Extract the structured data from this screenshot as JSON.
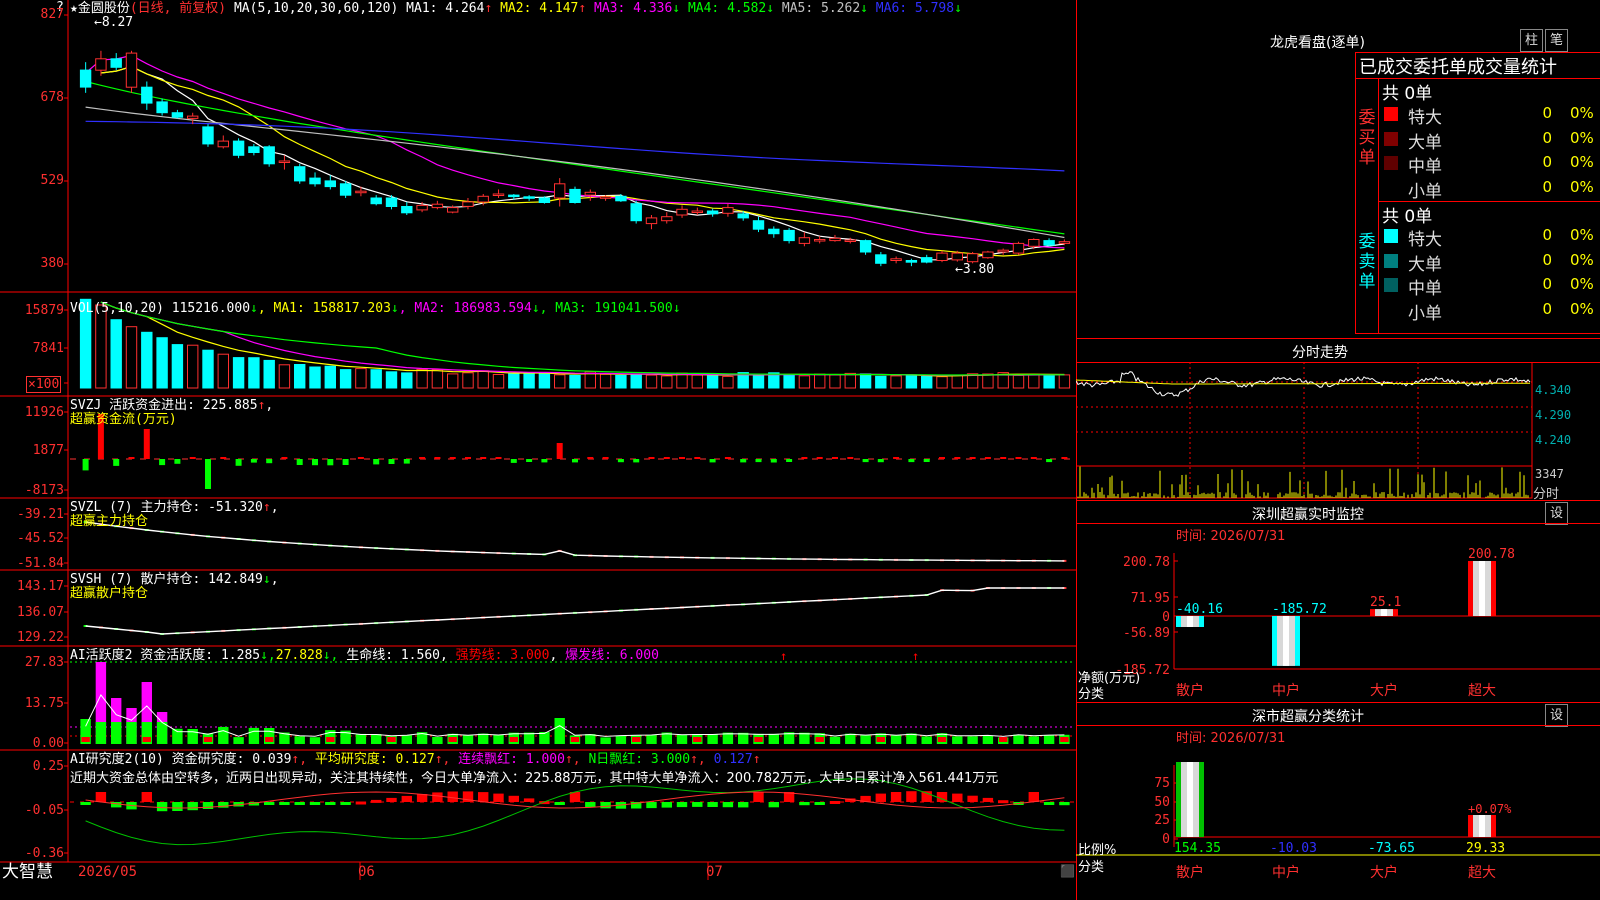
{
  "app": {
    "name": "大智慧",
    "corner_mark": "?"
  },
  "main_chart": {
    "title": "★金圆股份",
    "period": "(日线, 前复权)",
    "ma_head": "MA(5,10,20,30,60,120)",
    "ma": [
      {
        "text": "MA1: 4.264",
        "arrow": "↑",
        "color": "#ffffff"
      },
      {
        "text": "MA2: 4.147",
        "arrow": "↑",
        "color": "#ffff00"
      },
      {
        "text": "MA3: 4.336",
        "arrow": "↓",
        "color": "#ff00ff"
      },
      {
        "text": "MA4: 4.582",
        "arrow": "↓",
        "color": "#00ff00"
      },
      {
        "text": "MA5: 5.262",
        "arrow": "↓",
        "color": "#c0c0c0"
      },
      {
        "text": "MA6: 5.798",
        "arrow": "↓",
        "color": "#3030ff"
      }
    ],
    "y_ticks": [
      "827",
      "678",
      "529",
      "380"
    ],
    "high_mark": "8.27",
    "low_mark": "3.80",
    "candles": [
      [
        7.3,
        7.0,
        7.44,
        6.9
      ],
      [
        7.3,
        7.5,
        7.64,
        7.2
      ],
      [
        7.5,
        7.35,
        7.6,
        7.3
      ],
      [
        7.0,
        7.6,
        7.64,
        6.9
      ],
      [
        7.0,
        6.72,
        7.1,
        6.6
      ],
      [
        6.74,
        6.55,
        6.8,
        6.5
      ],
      [
        6.55,
        6.47,
        6.6,
        6.45
      ],
      [
        6.45,
        6.49,
        6.55,
        6.35
      ],
      [
        6.3,
        6.0,
        6.35,
        5.95
      ],
      [
        5.95,
        6.05,
        6.15,
        5.92
      ],
      [
        6.05,
        5.8,
        6.1,
        5.75
      ],
      [
        5.95,
        5.85,
        6.0,
        5.8
      ],
      [
        5.95,
        5.65,
        5.98,
        5.6
      ],
      [
        5.7,
        5.7,
        5.8,
        5.55
      ],
      [
        5.6,
        5.35,
        5.65,
        5.3
      ],
      [
        5.4,
        5.3,
        5.5,
        5.25
      ],
      [
        5.35,
        5.25,
        5.45,
        5.2
      ],
      [
        5.3,
        5.1,
        5.35,
        5.05
      ],
      [
        5.15,
        5.17,
        5.25,
        5.08
      ],
      [
        5.05,
        4.95,
        5.1,
        4.92
      ],
      [
        5.05,
        4.9,
        5.1,
        4.85
      ],
      [
        4.9,
        4.79,
        4.98,
        4.75
      ],
      [
        4.84,
        4.92,
        4.98,
        4.8
      ],
      [
        4.88,
        4.94,
        5.0,
        4.85
      ],
      [
        4.8,
        4.88,
        4.92,
        4.78
      ],
      [
        4.9,
        4.98,
        5.05,
        4.85
      ],
      [
        4.98,
        5.08,
        5.12,
        4.92
      ],
      [
        5.1,
        5.12,
        5.2,
        5.05
      ],
      [
        5.1,
        5.08,
        5.12,
        5.02
      ],
      [
        5.07,
        5.05,
        5.1,
        5.0
      ],
      [
        5.05,
        4.97,
        5.08,
        4.95
      ],
      [
        5.05,
        5.3,
        5.4,
        4.9
      ],
      [
        5.2,
        4.97,
        5.25,
        4.95
      ],
      [
        5.1,
        5.15,
        5.2,
        5.0
      ],
      [
        5.05,
        5.07,
        5.1,
        5.0
      ],
      [
        5.08,
        5.0,
        5.12,
        4.98
      ],
      [
        4.95,
        4.65,
        5.0,
        4.6
      ],
      [
        4.6,
        4.7,
        4.75,
        4.5
      ],
      [
        4.65,
        4.72,
        4.8,
        4.6
      ],
      [
        4.75,
        4.85,
        4.92,
        4.7
      ],
      [
        4.8,
        4.82,
        4.88,
        4.75
      ],
      [
        4.82,
        4.77,
        4.86,
        4.72
      ],
      [
        4.78,
        4.88,
        4.95,
        4.72
      ],
      [
        4.77,
        4.7,
        4.82,
        4.65
      ],
      [
        4.65,
        4.5,
        4.72,
        4.45
      ],
      [
        4.5,
        4.42,
        4.55,
        4.35
      ],
      [
        4.48,
        4.3,
        4.52,
        4.25
      ],
      [
        4.25,
        4.35,
        4.45,
        4.2
      ],
      [
        4.3,
        4.32,
        4.38,
        4.25
      ],
      [
        4.3,
        4.34,
        4.4,
        4.28
      ],
      [
        4.3,
        4.31,
        4.35,
        4.25
      ],
      [
        4.3,
        4.1,
        4.32,
        4.05
      ],
      [
        4.05,
        3.9,
        4.1,
        3.85
      ],
      [
        3.95,
        3.98,
        4.02,
        3.9
      ],
      [
        3.95,
        3.92,
        3.98,
        3.85
      ],
      [
        4.0,
        3.92,
        4.05,
        3.9
      ],
      [
        3.95,
        4.08,
        4.12,
        3.92
      ],
      [
        3.96,
        4.08,
        4.12,
        3.93
      ],
      [
        3.93,
        4.07,
        4.1,
        3.9
      ],
      [
        4.0,
        4.1,
        4.12,
        3.98
      ],
      [
        4.1,
        4.13,
        4.16,
        4.05
      ],
      [
        4.08,
        4.25,
        4.28,
        4.05
      ],
      [
        4.2,
        4.32,
        4.34,
        4.15
      ],
      [
        4.3,
        4.22,
        4.34,
        4.2
      ],
      [
        4.25,
        4.28,
        4.32,
        4.22
      ]
    ]
  },
  "vol": {
    "head": "VOL(5,10,20)",
    "v": {
      "text": "115216.000",
      "arrow": "↓",
      "color": "#ffffff"
    },
    "ma1": {
      "text": "MA1: 158817.203",
      "arrow": "↓",
      "color": "#ffff00"
    },
    "ma2": {
      "text": "MA2: 186983.594",
      "arrow": "↓",
      "color": "#ff00ff"
    },
    "ma3": {
      "text": "MA3: 191041.500",
      "arrow": "↓",
      "color": "#00ff00"
    },
    "y_ticks": [
      "15879",
      "7841",
      "×100"
    ]
  },
  "svzj": {
    "head": "SVZJ  活跃资金进出: 225.885",
    "arrow": "↑",
    "sub": "超赢资金流(万元)",
    "y_ticks": [
      "11926",
      "1877",
      "-8173"
    ]
  },
  "svzl": {
    "head": "SVZL (7) 主力持仓: -51.320",
    "arrow": "↑",
    "sub": "超赢主力持仓",
    "y_ticks": [
      "-39.21",
      "-45.52",
      "-51.84"
    ]
  },
  "svsh": {
    "head": "SVSH (7) 散户持仓: 142.849",
    "arrow": "↓",
    "sub": "超赢散户持仓",
    "y_ticks": [
      "143.17",
      "136.07",
      "129.22"
    ]
  },
  "ai1": {
    "head": "AI活跃度2 资金活跃度: 1.285",
    "v2": "27.828",
    "v3": "生命线: 1.560",
    "v4": "强势线: 3.000",
    "v5": "爆发线: 6.000",
    "y_ticks": [
      "27.83",
      "13.75",
      "0.00"
    ]
  },
  "ai2": {
    "head": "AI研究度2(10) 资金研究度: 0.039",
    "avg": "平均研究度: 0.127",
    "lian": "连续飘红: 1.000",
    "n": "N日飘红: 3.000",
    "last": "0.127",
    "summary": "近期大资金总体由空转多，近两日出现异动，关注其持续性，今日大单净流入：225.88万元，其中特大单净流入：200.782万元，大单5日累计净入561.441万元",
    "y_ticks": [
      "0.25",
      "-0.05",
      "-0.36"
    ]
  },
  "x_axis": {
    "labels": [
      "2026/05",
      "06",
      "07"
    ]
  },
  "right_panel": {
    "lhb_title": "龙虎看盘(逐单)",
    "btn_bar": "柱",
    "btn_bi": "笔",
    "stats_title": "已成交委托单成交量统计",
    "buy": {
      "label": "委买单",
      "total": "共 0单",
      "rows": [
        {
          "name": "特大",
          "count": "0",
          "pct": "0%",
          "color": "#ff0000"
        },
        {
          "name": "大单",
          "count": "0",
          "pct": "0%",
          "color": "#800000"
        },
        {
          "name": "中单",
          "count": "0",
          "pct": "0%",
          "color": "#600000"
        },
        {
          "name": "小单",
          "count": "0",
          "pct": "0%",
          "color": "#000000"
        }
      ]
    },
    "sell": {
      "label": "委卖单",
      "total": "共 0单",
      "rows": [
        {
          "name": "特大",
          "count": "0",
          "pct": "0%",
          "color": "#00ffff"
        },
        {
          "name": "大单",
          "count": "0",
          "pct": "0%",
          "color": "#008080"
        },
        {
          "name": "中单",
          "count": "0",
          "pct": "0%",
          "color": "#006060"
        },
        {
          "name": "小单",
          "count": "0",
          "pct": "0%",
          "color": "#000000"
        }
      ]
    },
    "intraday": {
      "title": "分时走势",
      "y_ticks": [
        "4.340",
        "4.290",
        "4.240"
      ],
      "vol_top": "3347",
      "vol_unit": "分时"
    },
    "monitor": {
      "title": "深圳超赢实时监控",
      "btn": "设",
      "time": "时间: 2026/07/31",
      "y_ticks": [
        "200.78",
        "71.95",
        "0",
        "-56.89",
        "-185.72"
      ],
      "y_caption_1": "净额(万元)",
      "y_caption_2": "分类",
      "bars": [
        {
          "cat": "散户",
          "value": -40.16,
          "label": "-40.16",
          "label_color": "#00ffff"
        },
        {
          "cat": "中户",
          "value": -185.72,
          "label": "-185.72",
          "label_color": "#00ffff"
        },
        {
          "cat": "大户",
          "value": 25.1,
          "label": "25.1",
          "label_color": "#ff3030"
        },
        {
          "cat": "超大",
          "value": 200.78,
          "label": "200.78",
          "label_color": "#ff3030"
        }
      ]
    },
    "category": {
      "title": "深市超赢分类统计",
      "btn": "设",
      "time": "时间: 2026/07/31",
      "y_ticks": [
        "75",
        "50",
        "25",
        "0"
      ],
      "y_caption_1": "比例%",
      "y_caption_2": "分类",
      "pct_label": "+0.07%",
      "bars": [
        {
          "cat": "散户",
          "value": 154.35,
          "label": "154.35",
          "label_color": "#00ff00"
        },
        {
          "cat": "中户",
          "value": -10.03,
          "label": "-10.03",
          "label_color": "#3030ff"
        },
        {
          "cat": "大户",
          "value": -73.65,
          "label": "-73.65",
          "label_color": "#00ffff"
        },
        {
          "cat": "超大",
          "value": 29.33,
          "label": "29.33",
          "label_color": "#ffff00"
        }
      ]
    }
  }
}
